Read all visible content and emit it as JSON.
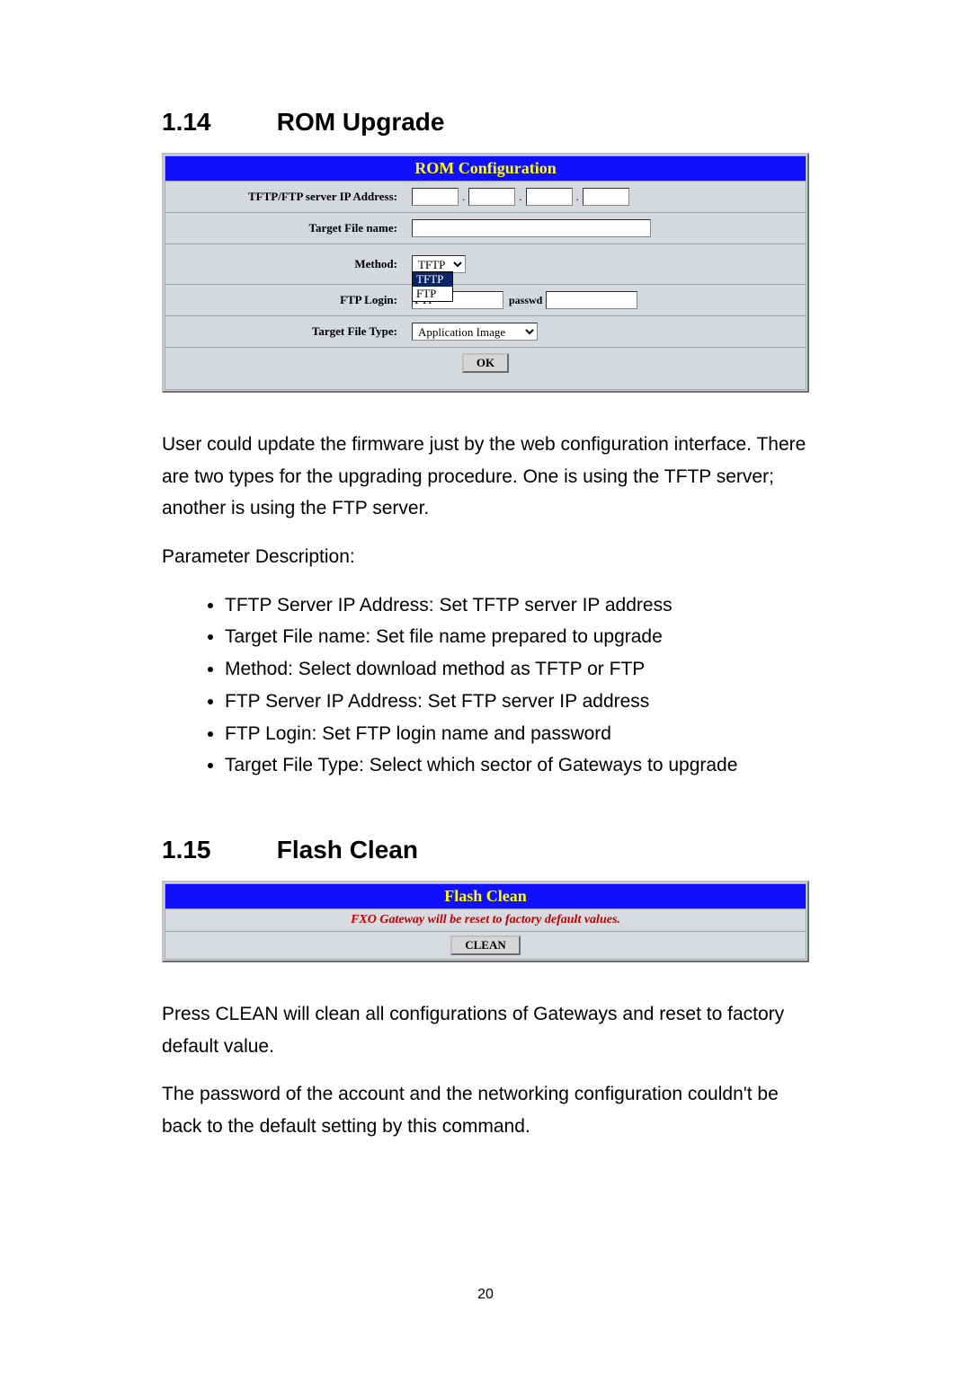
{
  "section1": {
    "number": "1.14",
    "title": "ROM Upgrade"
  },
  "rom": {
    "header": "ROM Configuration",
    "labels": {
      "ip": "TFTP/FTP server IP Address:",
      "file": "Target File name:",
      "method": "Method:",
      "ftp": "FTP Login:",
      "type": "Target File Type:"
    },
    "method_selected": "TFTP",
    "method_opts": {
      "a": "TFTP",
      "b": "FTP"
    },
    "ftp_value": "FTP",
    "passwd_label": "passwd",
    "type_selected": "Application Image",
    "ok": "OK"
  },
  "para1": "User could update the firmware just by the web configuration interface. There are two types for the upgrading procedure. One is using the TFTP server; another is using the FTP server.",
  "para2": "Parameter Description:",
  "bullets": {
    "b1": "TFTP Server IP Address: Set TFTP server IP address",
    "b2": "Target File name: Set file name prepared to upgrade",
    "b3": "Method: Select download method as TFTP or FTP",
    "b4": "FTP Server IP Address: Set FTP server IP address",
    "b5": "FTP Login: Set FTP login name and password",
    "b6": "Target File Type: Select which sector of Gateways to upgrade"
  },
  "section2": {
    "number": "1.15",
    "title": "Flash Clean"
  },
  "flash": {
    "header": "Flash Clean",
    "warn": "FXO Gateway will be reset to factory default values.",
    "btn": "CLEAN"
  },
  "para3": "Press CLEAN will clean all configurations of Gateways and reset to factory default value.",
  "para4": "The password of the account and the networking configuration couldn't be back to the default setting by this command.",
  "pagenum": "20"
}
